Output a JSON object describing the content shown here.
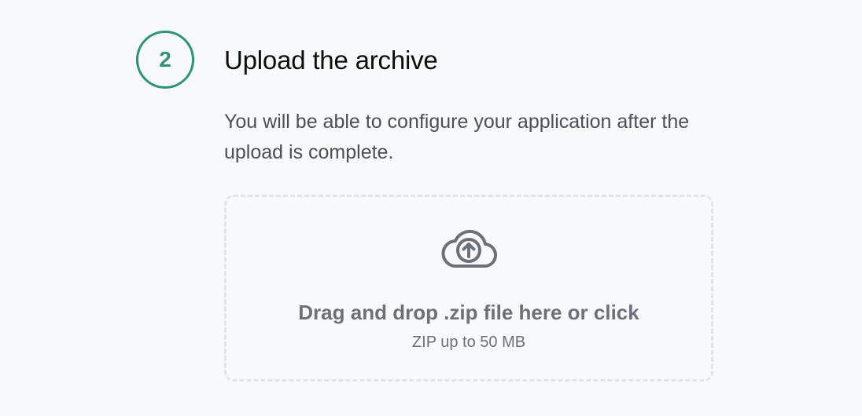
{
  "step": {
    "number": "2",
    "title": "Upload the archive",
    "description": "You will be able to configure your application after the upload is complete."
  },
  "dropzone": {
    "icon": "cloud-upload-icon",
    "label": "Drag and drop .zip file here or click",
    "hint": "ZIP up to 50 MB"
  },
  "colors": {
    "accent": "#2e9472",
    "muted_text": "#6b7079",
    "border": "#e2e4e8",
    "background": "#f8f9fb"
  }
}
